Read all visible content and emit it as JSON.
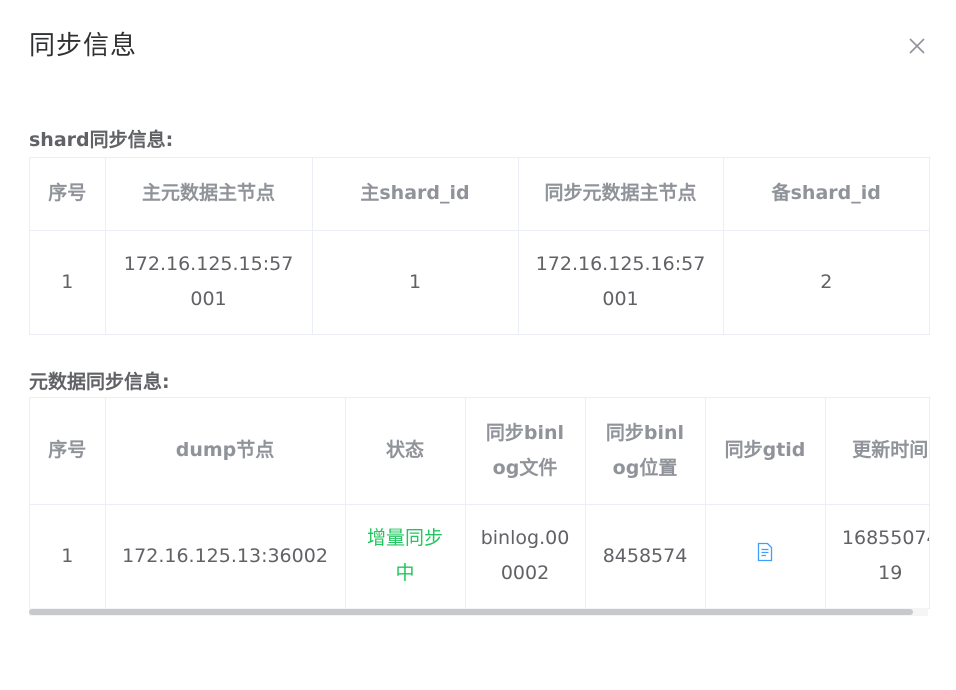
{
  "dialog": {
    "title": "同步信息"
  },
  "shard_section": {
    "title": "shard同步信息:",
    "headers": [
      "序号",
      "主元数据主节点",
      "主shard_id",
      "同步元数据主节点",
      "备shard_id"
    ],
    "rows": [
      [
        "1",
        "172.16.125.15:57001",
        "1",
        "172.16.125.16:57001",
        "2"
      ]
    ]
  },
  "meta_section": {
    "title": "元数据同步信息:",
    "headers": [
      "序号",
      "dump节点",
      "状态",
      "同步binlog文件",
      "同步binlog位置",
      "同步gtid",
      "更新时间"
    ],
    "rows": [
      {
        "index": "1",
        "dump_node": "172.16.125.13:36002",
        "status": "增量同步中",
        "binlog_file": "binlog.000002",
        "binlog_pos": "8458574",
        "gtid_icon": "document-icon",
        "updated": "1685507419"
      }
    ],
    "status_color": "#22c55e"
  },
  "colors": {
    "header_text": "#909399",
    "cell_text": "#606266",
    "border": "#ebeef5",
    "icon_blue": "#409eff"
  }
}
